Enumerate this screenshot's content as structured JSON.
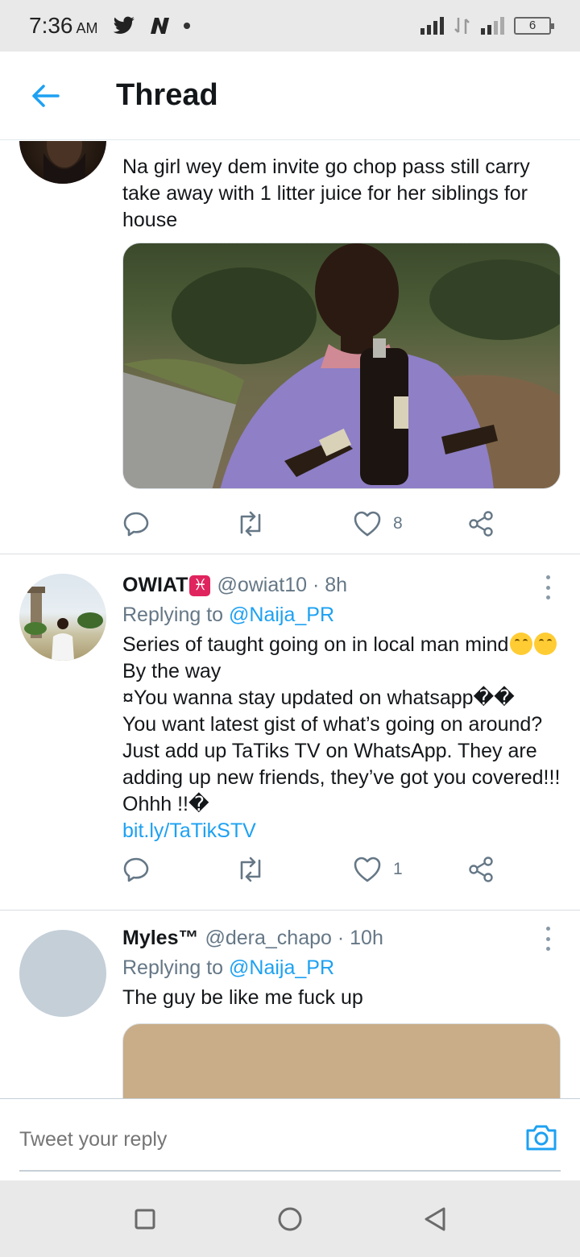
{
  "status_bar": {
    "time": "7:36",
    "am_pm": "AM",
    "battery": "6"
  },
  "header": {
    "title": "Thread"
  },
  "tweets": [
    {
      "text": "Na girl wey dem invite go chop pass still carry take away with 1 litter juice for her siblings for house",
      "likes": "8"
    },
    {
      "name": "OWIAT",
      "handle": "@owiat10 · 8h",
      "reply_prefix": "Replying to",
      "reply_to": "@Naija_PR",
      "line1": "Series of taught going on in local man mind",
      "line2": "By the way",
      "line3": "¤You wanna stay updated on whatsapp��",
      "line4": "You want latest gist of what’s going on around? Just add up TaTiks TV on WhatsApp. They are adding up new friends, they’ve got you covered!!! Ohhh !!�",
      "link": "bit.ly/TaTikSTV",
      "likes": "1"
    },
    {
      "name": "Myles™",
      "handle": "@dera_chapo · 10h",
      "reply_prefix": "Replying to",
      "reply_to": "@Naija_PR",
      "text": "The guy be like me fuck up"
    }
  ],
  "reply_bar": {
    "placeholder": "Tweet your reply"
  },
  "colors": {
    "accent": "#1da1f2",
    "secondary_text": "#657786",
    "primary_text": "#14171a",
    "media_placeholder": "#c8ad88"
  },
  "icons": [
    "back-arrow-icon",
    "reply-icon",
    "retweet-icon",
    "like-icon",
    "share-icon",
    "more-icon",
    "camera-icon",
    "pisces-icon",
    "laugh-emoji-icon"
  ]
}
